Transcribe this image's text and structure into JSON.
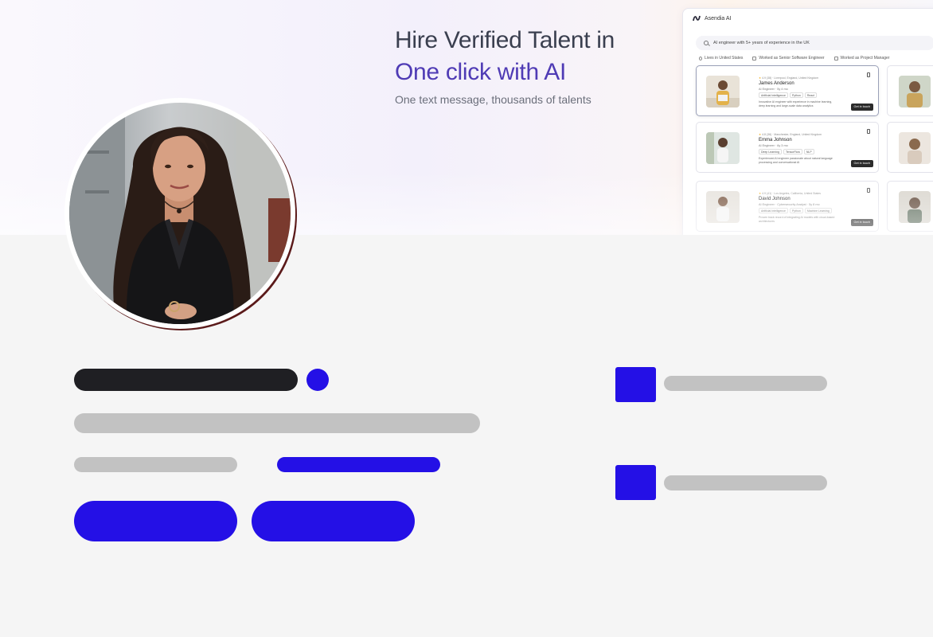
{
  "banner": {
    "title_line1": "Hire Verified Talent in",
    "title_line2": "One click with AI",
    "subtitle": "One text message, thousands of talents"
  },
  "app": {
    "name": "Asendia AI",
    "search_query": "AI engineer with 5+ years of experience in the UK",
    "filters": [
      "Lives in United States",
      "Worked as Senior Software Engineer",
      "Worked as Project Manager"
    ],
    "cards": [
      {
        "meta": "4.9 (38) · Liverpool, England, United Kingdom",
        "name": "James Anderson",
        "role": "AI Engineer · 5y 4 mo",
        "tags": [
          "Artificial Intelligence",
          "Python",
          "React"
        ],
        "desc": "Innovative AI engineer with experience in machine learning, deep learning and large-scale data analytics",
        "button": "Get in touch"
      },
      {
        "meta": "4.8 (36) · Manchester, England, United Kingdom",
        "name": "Emma Johnson",
        "role": "AI Engineer · 6y 3 mo",
        "tags": [
          "Deep Learning",
          "TensorFlow",
          "NLP"
        ],
        "desc": "Experienced AI engineer passionate about natural language processing and conversational AI",
        "button": "Get in touch"
      },
      {
        "meta": "4.9 (41) · Los Angeles, California, United States",
        "name": "David Johnson",
        "role": "AI Engineer · Cybersecurity Analyst · 5y 8 mo",
        "tags": [
          "Artificial Intelligence",
          "Python",
          "Machine Learning"
        ],
        "desc": "Proven track record of integrating AI models with cloud-based architectures",
        "button": "Get in touch"
      }
    ]
  },
  "colors": {
    "accent": "#2410e6",
    "skeleton_dark": "#1f1f23",
    "skeleton_gray": "#c2c2c2",
    "page_bg": "#f5f5f5",
    "brand_purple": "#4f3bb5"
  }
}
